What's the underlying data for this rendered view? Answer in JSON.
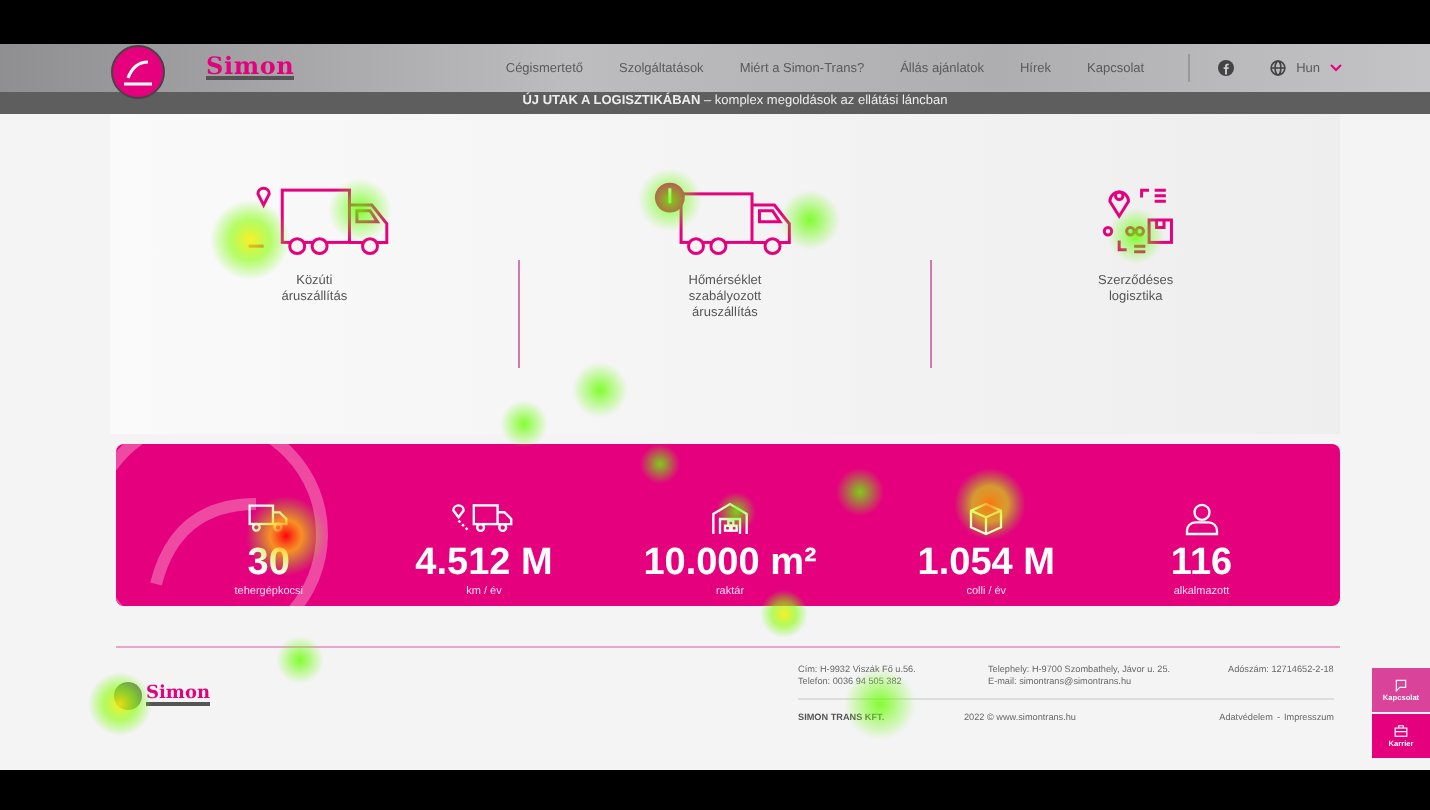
{
  "header": {
    "logo_text": "Simon",
    "nav": [
      {
        "label": "Cégismertető"
      },
      {
        "label": "Szolgáltatások"
      },
      {
        "label": "Miért a Simon-Trans?"
      },
      {
        "label": "Állás ajánlatok"
      },
      {
        "label": "Hírek"
      },
      {
        "label": "Kapcsolat"
      }
    ],
    "language": "Hun"
  },
  "tagline": "**ÚJ UTAK A LOGISZTIKÁBAN** – komplex megoldások az ellátási láncban",
  "services": [
    {
      "kind": "truck",
      "label": "Közúti\náruszállítás"
    },
    {
      "kind": "cold",
      "label": "Hőmérséklet\nszabályozott\náruszállítás"
    },
    {
      "kind": "contract",
      "label": "Szerződéses\nlogisztika"
    }
  ],
  "stats": [
    {
      "kind": "truck",
      "value": "30",
      "label": "tehergépkocsi"
    },
    {
      "kind": "route",
      "value": "4.512 M",
      "label": "km / év"
    },
    {
      "kind": "warehouse",
      "value": "10.000 m²",
      "label": "raktár"
    },
    {
      "kind": "box",
      "value": "1.054 M",
      "label": "colli / év"
    },
    {
      "kind": "person",
      "value": "116",
      "label": "alkalmazott"
    }
  ],
  "footer": {
    "logo_text": "Simon",
    "address": "Cím: H-9932 Viszák Fő u.56.",
    "phone": "Telefon: 0036 94 505 382",
    "site": "Telephely: H-9700 Szombathely, Jávor u. 25.",
    "email": "E-mail: simontrans@simontrans.hu",
    "tax": "Adószám: 12714652-2-18",
    "company": "SIMON TRANS KFT.",
    "copyright": "2022 © www.simontrans.hu",
    "links": [
      "Adatvédelem",
      "-",
      "Impresszum"
    ]
  },
  "side_buttons": [
    {
      "kind": "contact",
      "label": "Kapcsolat"
    },
    {
      "kind": "career",
      "label": "Karrier"
    }
  ]
}
